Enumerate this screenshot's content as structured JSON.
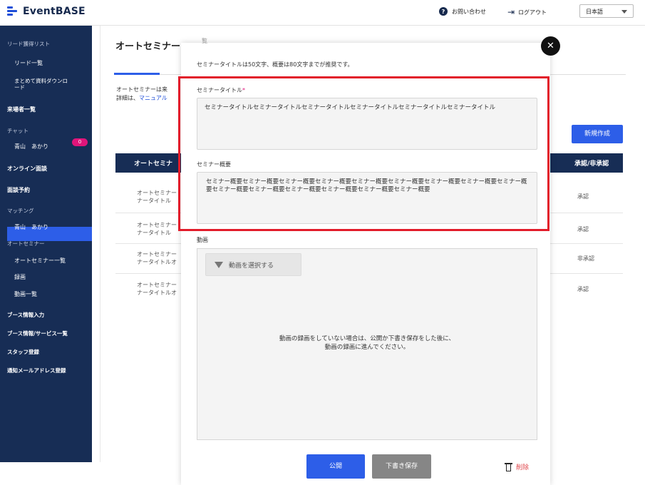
{
  "header": {
    "logo_text": "EventBASE",
    "help_label": "お問い合わせ",
    "help_icon": "?",
    "logout_label": "ログアウト",
    "logout_icon": "⇥",
    "language": "日本語"
  },
  "sidebar": {
    "cat_lead": "リード獲得リスト",
    "lead_list": "リード一覧",
    "bulk_download": "まとめて資料ダウンロ",
    "bulk_download_2": "ード",
    "visitor_list": "来場者一覧",
    "cat_chat": "チャット",
    "chat_user": "青山　あかり",
    "online_meeting": "オンライン面談",
    "online_meeting_badge": "0",
    "meeting_reservation": "面談予約",
    "cat_matching": "マッチング",
    "matching_user": "青山　あかり",
    "cat_auto_seminar": "オートセミナー",
    "auto_seminar_list": "オートセミナー一覧",
    "recording": "録画",
    "video_list": "動画一覧",
    "booth_input": "ブース情報入力",
    "booth_list": "ブース情報/サービス一覧",
    "staff_register": "スタッフ登録",
    "notify_mail": "通知メールアドレス登録"
  },
  "main": {
    "page_title": "オートセミナー",
    "desc_line1": "オートセミナーは来",
    "desc_line2_prefix": "詳細は、",
    "desc_link": "マニュアル",
    "new_button": "新規作成",
    "table_headers": {
      "title": "オートセミナ",
      "approval": "承認/非承認"
    },
    "rows": [
      {
        "title_1": "オートセミナー",
        "title_2": "ナータイトル",
        "status": "承認"
      },
      {
        "title_1": "オートセミナー",
        "title_2": "ナータイトル",
        "status": "承認"
      },
      {
        "title_1": "オートセミナー",
        "title_2": "ナータイトルオ",
        "status": "非承認"
      },
      {
        "title_1": "オートセミナー",
        "title_2": "ナータイトルオ",
        "status": "承認"
      }
    ]
  },
  "modal": {
    "tab_fragment": "覧",
    "close_icon": "✕",
    "note": "セミナータイトルは50文字、概要は80文字までが推奨です。",
    "title_label": "セミナータイトル",
    "required_mark": "*",
    "title_value": "セミナータイトルセミナータイトルセミナータイトルセミナータイトルセミナータイトルセミナータイトル",
    "summary_label": "セミナー概要",
    "summary_value": "セミナー概要セミナー概要セミナー概要セミナー概要セミナー概要セミナー概要セミナー概要セミナー概要セミナー概要セミナー概要セミナー概要セミナー概要セミナー概要セミナー概要セミナー概要",
    "video_label": "動画",
    "video_select": "動画を選択する",
    "video_msg_1": "動画の録画をしていない場合は、公開か下書き保存をした後に、",
    "video_msg_2": "動画の録画に進んでください。",
    "publish_button": "公開",
    "draft_button": "下書き保存",
    "delete_button": "削除"
  },
  "colors": {
    "sidebar_bg": "#172d55",
    "accent": "#2d5ee8",
    "highlight": "#e21c2a",
    "badge": "#e0157a",
    "delete": "#e0474c"
  }
}
